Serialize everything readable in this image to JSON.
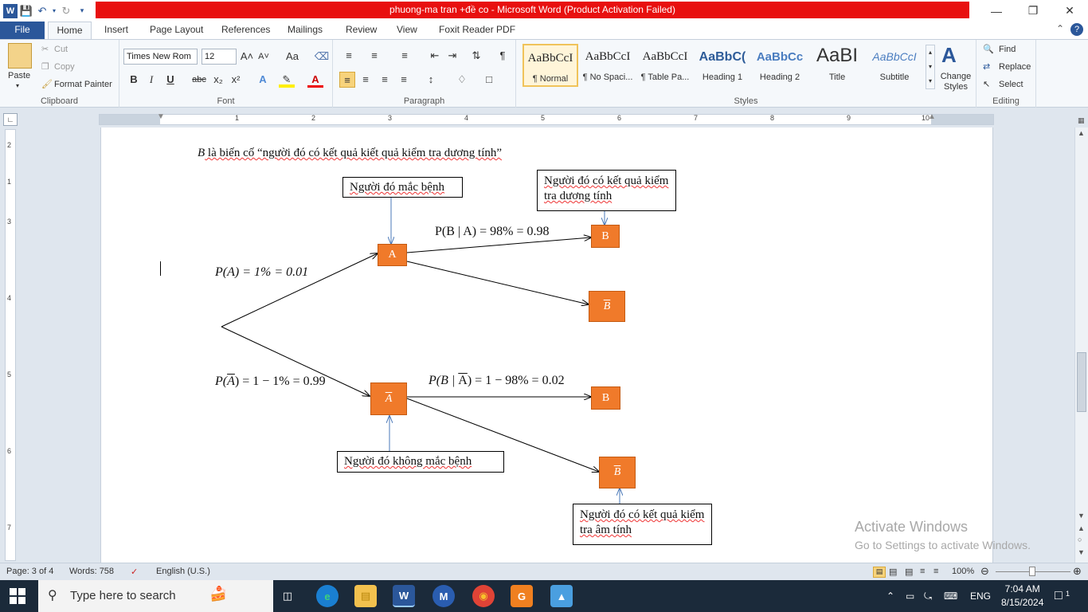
{
  "window": {
    "title": "phuong-ma tran +đề co  -  Microsoft Word (Product Activation Failed)"
  },
  "tabs": [
    "File",
    "Home",
    "Insert",
    "Page Layout",
    "References",
    "Mailings",
    "Review",
    "View",
    "Foxit Reader PDF"
  ],
  "ribbon": {
    "clipboard": {
      "label": "Clipboard",
      "paste": "Paste",
      "cut": "Cut",
      "copy": "Copy",
      "format_painter": "Format Painter"
    },
    "font": {
      "label": "Font",
      "font_name": "Times New Rom",
      "font_size": "12",
      "change_case": "Aa",
      "bold": "B",
      "italic": "I",
      "underline": "U",
      "strike": "abc",
      "subscript": "x₂",
      "superscript": "x²"
    },
    "paragraph": {
      "label": "Paragraph"
    },
    "styles": {
      "label": "Styles",
      "items": [
        {
          "sample": "AaBbCcI",
          "name": "¶ Normal"
        },
        {
          "sample": "AaBbCcI",
          "name": "¶ No Spaci..."
        },
        {
          "sample": "AaBbCcI",
          "name": "¶ Table Pa..."
        },
        {
          "sample": "AaBbC(",
          "name": "Heading 1"
        },
        {
          "sample": "AaBbCc",
          "name": "Heading 2"
        },
        {
          "sample": "AaBI",
          "name": "Title"
        },
        {
          "sample": "AaBbCcI",
          "name": "Subtitle"
        }
      ],
      "change_styles": "Change Styles"
    },
    "editing": {
      "label": "Editing",
      "find": "Find",
      "replace": "Replace",
      "select": "Select"
    }
  },
  "ruler": {
    "h_numbers": [
      "1",
      "2",
      "3",
      "4",
      "5",
      "6",
      "7",
      "8",
      "9",
      "10"
    ],
    "v_numbers": [
      "2",
      "1",
      "3",
      "4",
      "5",
      "6",
      "7"
    ]
  },
  "document": {
    "line_b_var": "B",
    "line_b_text": " là biến cố “người đó có kết quả kiết quả kiểm tra dương tính”",
    "box_sick": "Người đó mắc bệnh",
    "box_positive": "Người đó có kết quả kiểm tra dương tính",
    "box_not_sick": "Người đó không mắc bệnh",
    "box_negative": "Người đó có kết quả kiểm tra âm tính",
    "node_a": "A",
    "node_b1": "B",
    "node_bbar1": "B",
    "node_abar": "A",
    "node_b2": "B",
    "node_bbar2": "B",
    "p_a": "P(A) = 1% = 0.01",
    "p_abar_pre": "P(",
    "p_abar_a": "A",
    "p_abar_post": ") = 1 − 1% = 0.99",
    "p_b_given_a": "P(B | A) = 98% = 0.98",
    "p_b_given_abar_pre": "P(B | ",
    "p_b_given_abar_a": "A",
    "p_b_given_abar_post": ") = 1 − 98% = 0.02",
    "watermark_title": "Activate Windows",
    "watermark_sub": "Go to Settings to activate Windows."
  },
  "status": {
    "page": "Page: 3 of 4",
    "words": "Words: 758",
    "language": "English (U.S.)",
    "zoom": "100%"
  },
  "taskbar": {
    "search_placeholder": "Type here to search",
    "lang": "ENG",
    "time": "7:04 AM",
    "date": "8/15/2024",
    "notif_count": "1"
  },
  "colors": {
    "title_red": "#e8100f",
    "word_blue": "#2b579a",
    "node_orange": "#f07a2a"
  }
}
